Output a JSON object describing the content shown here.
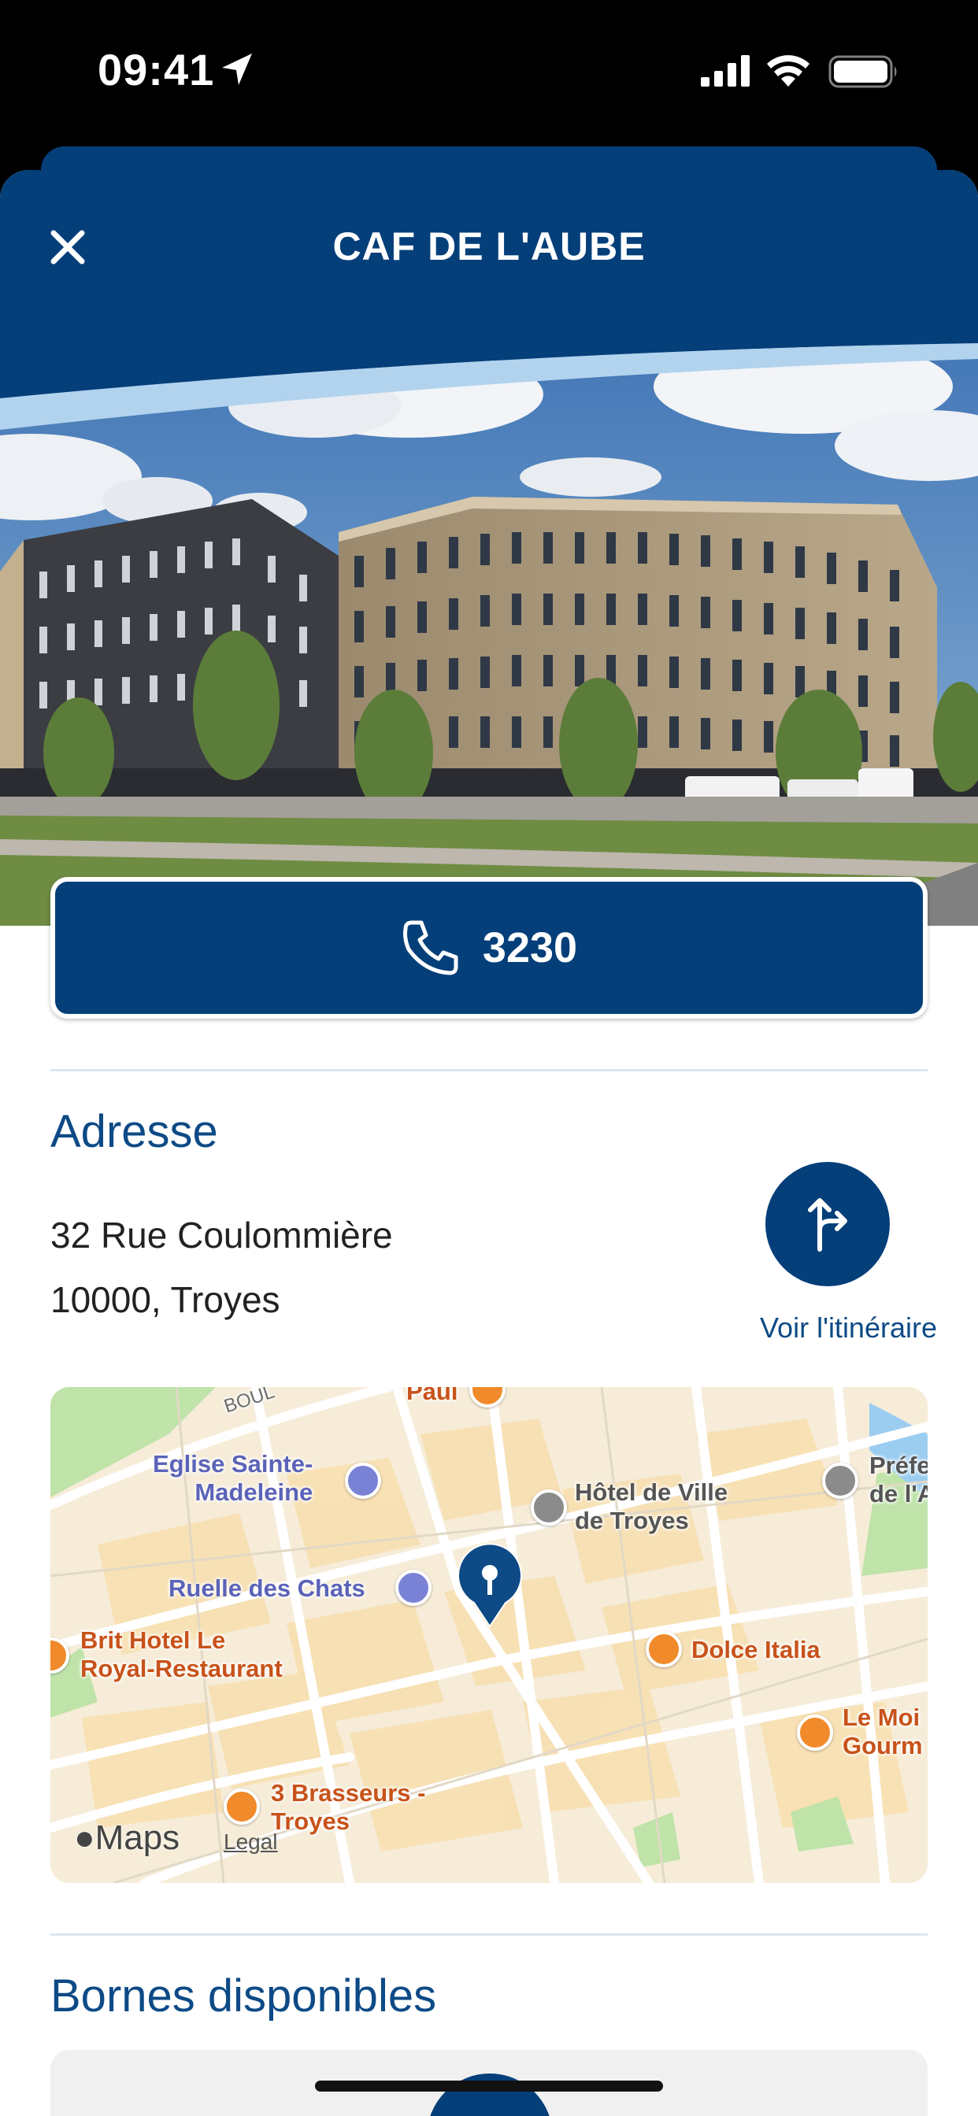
{
  "status_bar": {
    "time": "09:41"
  },
  "header": {
    "title": "CAF DE L'AUBE"
  },
  "phone": {
    "number": "3230"
  },
  "address": {
    "heading": "Adresse",
    "line1": "32 Rue Coulommière",
    "line2": "10000, Troyes",
    "route_label": "Voir l'itinéraire"
  },
  "map": {
    "street_label": "BOUL",
    "labels": {
      "paul": "Paul",
      "eglise": "Eglise Sainte-\nMadeleine",
      "hotel_ville": "Hôtel de Ville\nde Troyes",
      "prefecture": "Préfe\nde l'A",
      "ruelle": "Ruelle des Chats",
      "brit_hotel": "Brit Hotel Le\nRoyal-Restaurant",
      "dolce": "Dolce Italia",
      "le_moi": "Le Moi\nGourm",
      "brasseurs": "3 Brasseurs -\nTroyes"
    },
    "maps_logo": "Maps",
    "legal": "Legal"
  },
  "bornes": {
    "heading": "Bornes disponibles"
  },
  "colors": {
    "brand": "#053f7a",
    "accent_text": "#0d4a86"
  }
}
